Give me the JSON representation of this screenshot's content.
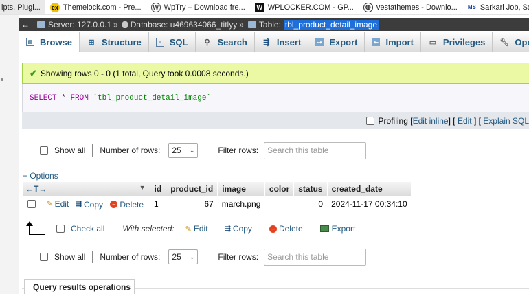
{
  "bookmarks": [
    {
      "label": "ipts, Plugi...",
      "icon": "page-icon"
    },
    {
      "label": "Themelock.com - Pre...",
      "icon": "ex-icon"
    },
    {
      "label": "WpTry – Download fre...",
      "icon": "wordpress-icon"
    },
    {
      "label": "WPLOCKER.COM - GP...",
      "icon": "wl-icon"
    },
    {
      "label": "vestathemes - Downlo...",
      "icon": "globe-icon"
    },
    {
      "label": "Sarkari Job, Sarkari Re...",
      "icon": "sarkari-icon"
    }
  ],
  "breadcrumb": {
    "server": "Server: 127.0.0.1",
    "database": "Database: u469634066_titlyy",
    "table_prefix": "Table:",
    "table": "tbl_product_detail_image",
    "separator": "»"
  },
  "tabs": [
    {
      "label": "Browse",
      "icon": "table-icon",
      "active": true
    },
    {
      "label": "Structure",
      "icon": "structure-icon"
    },
    {
      "label": "SQL",
      "icon": "sql-icon"
    },
    {
      "label": "Search",
      "icon": "search-icon"
    },
    {
      "label": "Insert",
      "icon": "insert-icon"
    },
    {
      "label": "Export",
      "icon": "export-icon"
    },
    {
      "label": "Import",
      "icon": "import-icon"
    },
    {
      "label": "Privileges",
      "icon": "privileges-icon"
    },
    {
      "label": "Operations",
      "icon": "wrench-icon"
    }
  ],
  "message": "Showing rows 0 - 0 (1 total, Query took 0.0008 seconds.)",
  "sql": {
    "select": "SELECT",
    "star": "*",
    "from": "FROM",
    "table": "`tbl_product_detail_image`"
  },
  "profiling": {
    "label": "Profiling",
    "edit_inline": "Edit inline",
    "edit": "Edit",
    "explain": "Explain SQL"
  },
  "nav": {
    "show_all": "Show all",
    "rows_label": "Number of rows:",
    "rows_value": "25",
    "filter_label": "Filter rows:",
    "filter_placeholder": "Search this table"
  },
  "options_link": "+ Options",
  "table": {
    "columns": [
      "id",
      "product_id",
      "image",
      "color",
      "status",
      "created_date"
    ],
    "rows": [
      {
        "id": "1",
        "product_id": "67",
        "image": "march.png",
        "color": "",
        "status": "0",
        "created_date": "2024-11-17 00:34:10"
      }
    ],
    "row_actions": {
      "edit": "Edit",
      "copy": "Copy",
      "delete": "Delete"
    }
  },
  "with_selected": {
    "check_all": "Check all",
    "label": "With selected:",
    "edit": "Edit",
    "copy": "Copy",
    "delete": "Delete",
    "export": "Export"
  },
  "query_results_operations": "Query results operations",
  "colors": {
    "link": "#235a81",
    "success_bg": "#ebf8a4",
    "crumb_bg": "#3c3c3c",
    "selection": "#1e6fd9"
  }
}
